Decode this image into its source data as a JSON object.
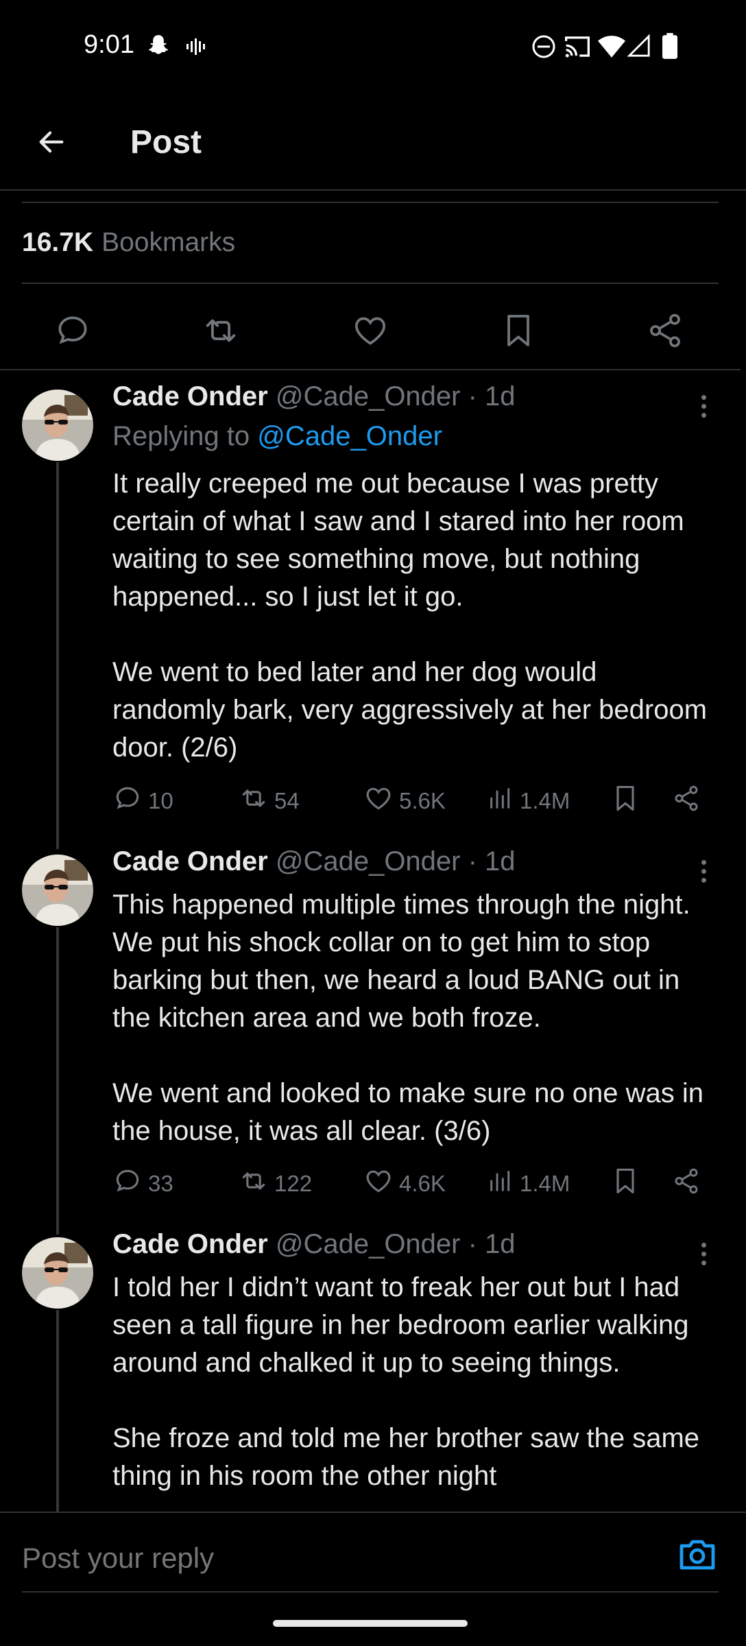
{
  "status_bar": {
    "time": "9:01",
    "left_icons": [
      "snapchat-icon",
      "voice-recorder-icon"
    ],
    "right_icons": [
      "do-not-disturb-icon",
      "cast-icon",
      "wifi-icon",
      "cellular-signal-icon",
      "battery-icon"
    ]
  },
  "header": {
    "title": "Post",
    "back_icon": "arrow-left-icon"
  },
  "main_post_stats": {
    "bookmark_count": "16.7K",
    "bookmark_label": "Bookmarks"
  },
  "main_actions": [
    "reply-icon",
    "repost-icon",
    "like-icon",
    "bookmark-icon",
    "share-icon"
  ],
  "tweets": [
    {
      "name": "Cade Onder",
      "handle_time": "@Cade_Onder · 1d",
      "replying_prefix": "Replying to",
      "replying_handle": "@Cade_Onder",
      "paragraphs": [
        "It really creeped me out because I was pretty certain of what I saw and I stared into her room waiting to see something move, but nothing happened... so I just let it go.",
        "We went to bed later and her dog would randomly bark, very aggressively at her bedroom door. (2/6)"
      ],
      "stats": {
        "replies": "10",
        "reposts": "54",
        "likes": "5.6K",
        "views": "1.4M"
      }
    },
    {
      "name": "Cade Onder",
      "handle_time": "@Cade_Onder · 1d",
      "paragraphs": [
        "This happened multiple times through the night. We put his shock collar on to get him to stop barking but then, we heard a loud BANG out in the kitchen area and we both froze.",
        "We went and looked to make sure no one was in the house, it was all clear. (3/6)"
      ],
      "stats": {
        "replies": "33",
        "reposts": "122",
        "likes": "4.6K",
        "views": "1.4M"
      }
    },
    {
      "name": "Cade Onder",
      "handle_time": "@Cade_Onder · 1d",
      "paragraphs": [
        "I told her I didn’t want to freak her out but I had seen a tall figure in her bedroom earlier walking around and chalked it up to seeing things.",
        "She froze and told me her brother saw the same thing in his room the other night"
      ]
    }
  ],
  "reply_bar": {
    "placeholder": "Post your reply",
    "camera_icon": "camera-icon"
  },
  "colors": {
    "background": "#000000",
    "text_primary": "#e7e9ea",
    "text_secondary": "#71767b",
    "accent": "#1d9bf0",
    "divider": "#2f3336"
  }
}
